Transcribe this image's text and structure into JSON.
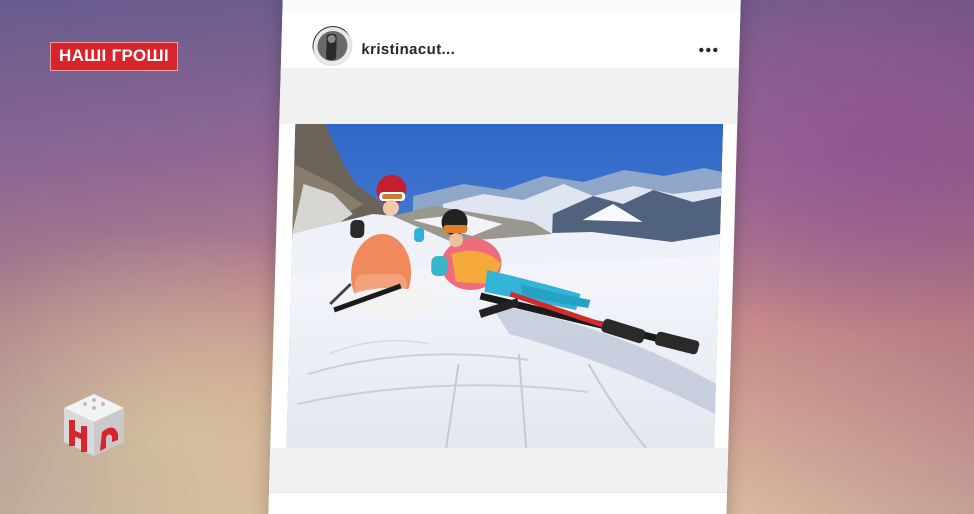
{
  "overlay": {
    "show_title": "НАШІ ГРОШІ",
    "channel_logo_icon": "nash-channel-cube-logo-icon",
    "accent_color": "#d8252c"
  },
  "post": {
    "username": "kristinacut...",
    "more_icon": "more-options-dots-icon",
    "avatar_icon": "profile-avatar",
    "photo_icon": "ski-slope-photo"
  }
}
